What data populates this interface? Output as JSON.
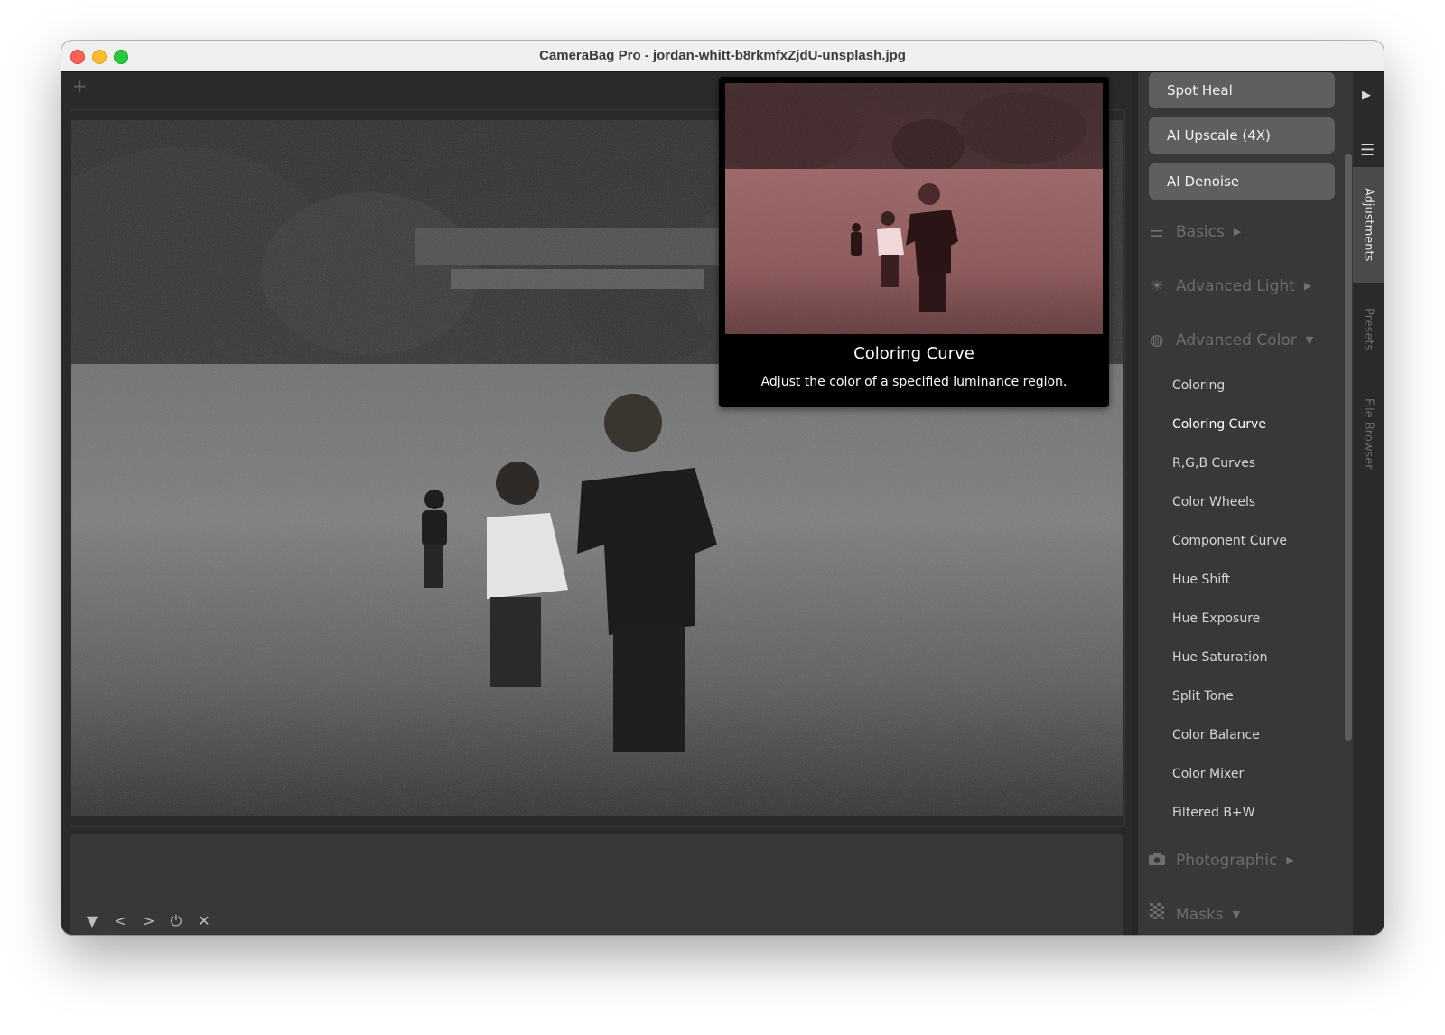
{
  "window": {
    "title": "CameraBag Pro - jordan-whitt-b8rkmfxZjdU-unsplash.jpg"
  },
  "tabbar": {
    "new_tab_icon": "plus-icon",
    "new_tab_glyph": "+"
  },
  "toolbar_bottom": {
    "items": [
      {
        "name": "collapse-icon",
        "glyph": "▼"
      },
      {
        "name": "previous-icon",
        "glyph": "<"
      },
      {
        "name": "next-icon",
        "glyph": ">"
      },
      {
        "name": "power-icon",
        "glyph": "⏻"
      },
      {
        "name": "close-icon",
        "glyph": "✕"
      }
    ]
  },
  "panel": {
    "tool_buttons": [
      "Spot Heal",
      "AI Upscale (4X)",
      "AI Denoise"
    ],
    "sections": [
      {
        "label": "Basics",
        "icon": "sliders-icon",
        "glyph": "⚌",
        "state": "collapsed",
        "arrow": "▶"
      },
      {
        "label": "Advanced Light",
        "icon": "sun-icon",
        "glyph": "☀",
        "state": "collapsed",
        "arrow": "▶"
      },
      {
        "label": "Advanced Color",
        "icon": "color-circles-icon",
        "glyph": "◍",
        "state": "expanded",
        "arrow": "▼"
      },
      {
        "label": "Photographic",
        "icon": "camera-icon",
        "glyph": "📷",
        "state": "collapsed",
        "arrow": "▶"
      },
      {
        "label": "Masks",
        "icon": "checker-icon",
        "glyph": "▦",
        "state": "expanded",
        "arrow": "▼"
      }
    ],
    "advanced_color_items": [
      "Coloring",
      "Coloring Curve",
      "R,G,B Curves",
      "Color Wheels",
      "Component Curve",
      "Hue Shift",
      "Hue Exposure",
      "Hue Saturation",
      "Split Tone",
      "Color Balance",
      "Color Mixer",
      "Filtered B+W"
    ],
    "hovered_item": "Coloring Curve"
  },
  "side_tabs": {
    "play_glyph": "▶",
    "menu_glyph": "☰",
    "tabs": [
      {
        "label": "Adjustments",
        "active": true
      },
      {
        "label": "Presets",
        "active": false
      },
      {
        "label": "File Browser",
        "active": false
      }
    ]
  },
  "tooltip": {
    "title": "Coloring Curve",
    "description": "Adjust the color of a specified luminance region.",
    "tint_color": "#8a4a4e"
  },
  "photo": {
    "description": "Black and white photo of three children running through a grassy field toward a treeline"
  }
}
